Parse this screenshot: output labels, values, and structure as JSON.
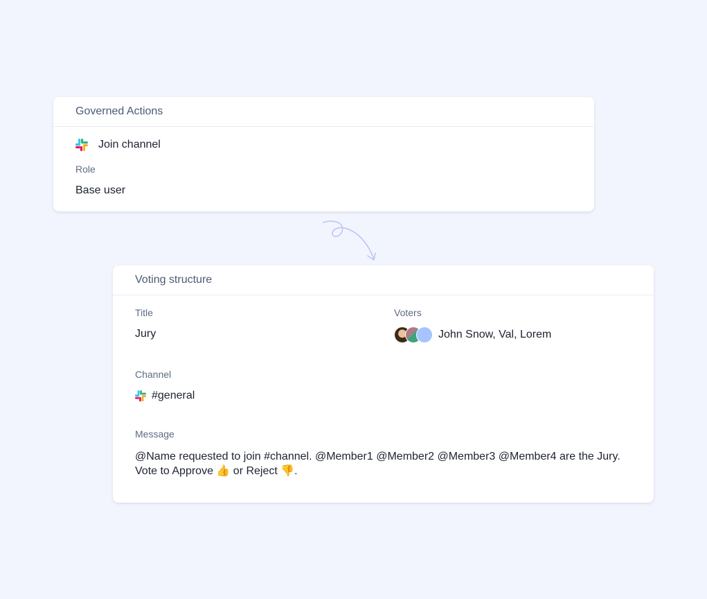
{
  "governed_actions": {
    "header": "Governed Actions",
    "action": {
      "icon": "slack-icon",
      "label": "Join channel"
    },
    "role_label": "Role",
    "role_value": "Base user"
  },
  "connector": {
    "icon": "curly-arrow-icon"
  },
  "voting_structure": {
    "header": "Voting structure",
    "title_label": "Title",
    "title_value": "Jury",
    "voters_label": "Voters",
    "voters_value": "John Snow, Val, Lorem",
    "voters": [
      {
        "name": "John Snow",
        "color": "#8a6a3c"
      },
      {
        "name": "Val",
        "color": "#5aa58c"
      },
      {
        "name": "Lorem",
        "color": "#a6c4ff"
      }
    ],
    "channel_label": "Channel",
    "channel_value": "#general",
    "channel_icon": "slack-icon",
    "message_label": "Message",
    "message_line1": "@Name requested to join #channel. @Member1 @Member2 @Member3 @Member4 are the Jury.",
    "message_line2": "Vote to Approve 👍 or Reject 👎."
  },
  "colors": {
    "background": "#f3f5fe",
    "card": "#ffffff",
    "label": "#5c6b82",
    "arrow": "#b9c6f5"
  }
}
